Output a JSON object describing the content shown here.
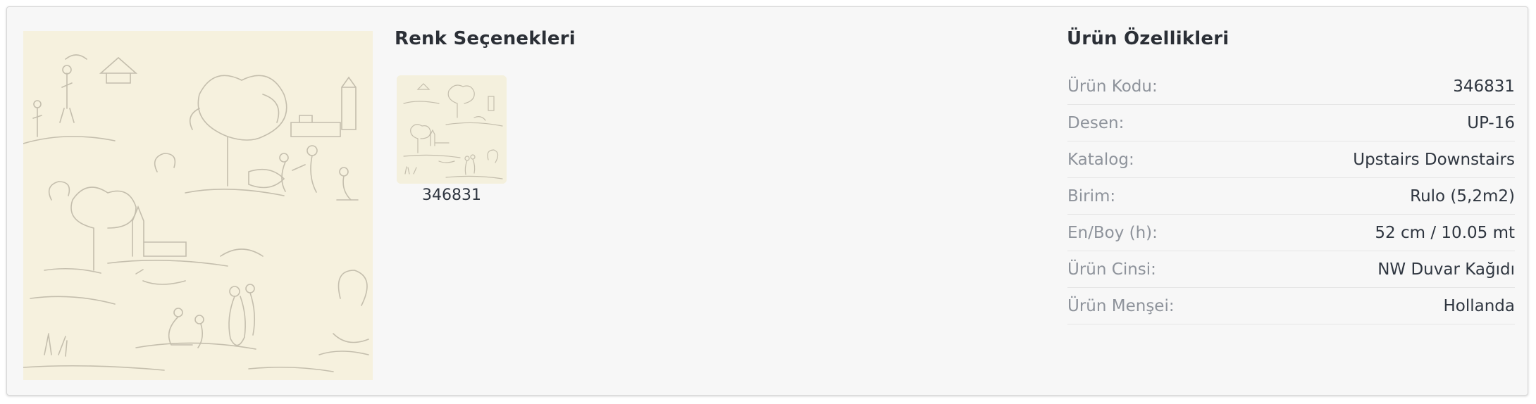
{
  "product_image": {
    "icon": "toile-pastoral-wallpaper-image"
  },
  "color_options": {
    "title": "Renk Seçenekleri",
    "swatches": [
      {
        "code": "346831"
      }
    ]
  },
  "properties": {
    "title": "Ürün Özellikleri",
    "rows": [
      {
        "label": "Ürün Kodu:",
        "value": "346831"
      },
      {
        "label": "Desen:",
        "value": "UP-16"
      },
      {
        "label": "Katalog:",
        "value": "Upstairs Downstairs"
      },
      {
        "label": "Birim:",
        "value": "Rulo (5,2m2)"
      },
      {
        "label": "En/Boy (h):",
        "value": "52 cm / 10.05 mt"
      },
      {
        "label": "Ürün Cinsi:",
        "value": "NW Duvar Kağıdı"
      },
      {
        "label": "Ürün Menşei:",
        "value": "Hollanda"
      }
    ]
  },
  "colors": {
    "card_bg": "#f7f7f7",
    "paper": "#f6f1de",
    "sketch": "#b9b3a2",
    "label": "#8e939b",
    "value": "#2f3640"
  }
}
